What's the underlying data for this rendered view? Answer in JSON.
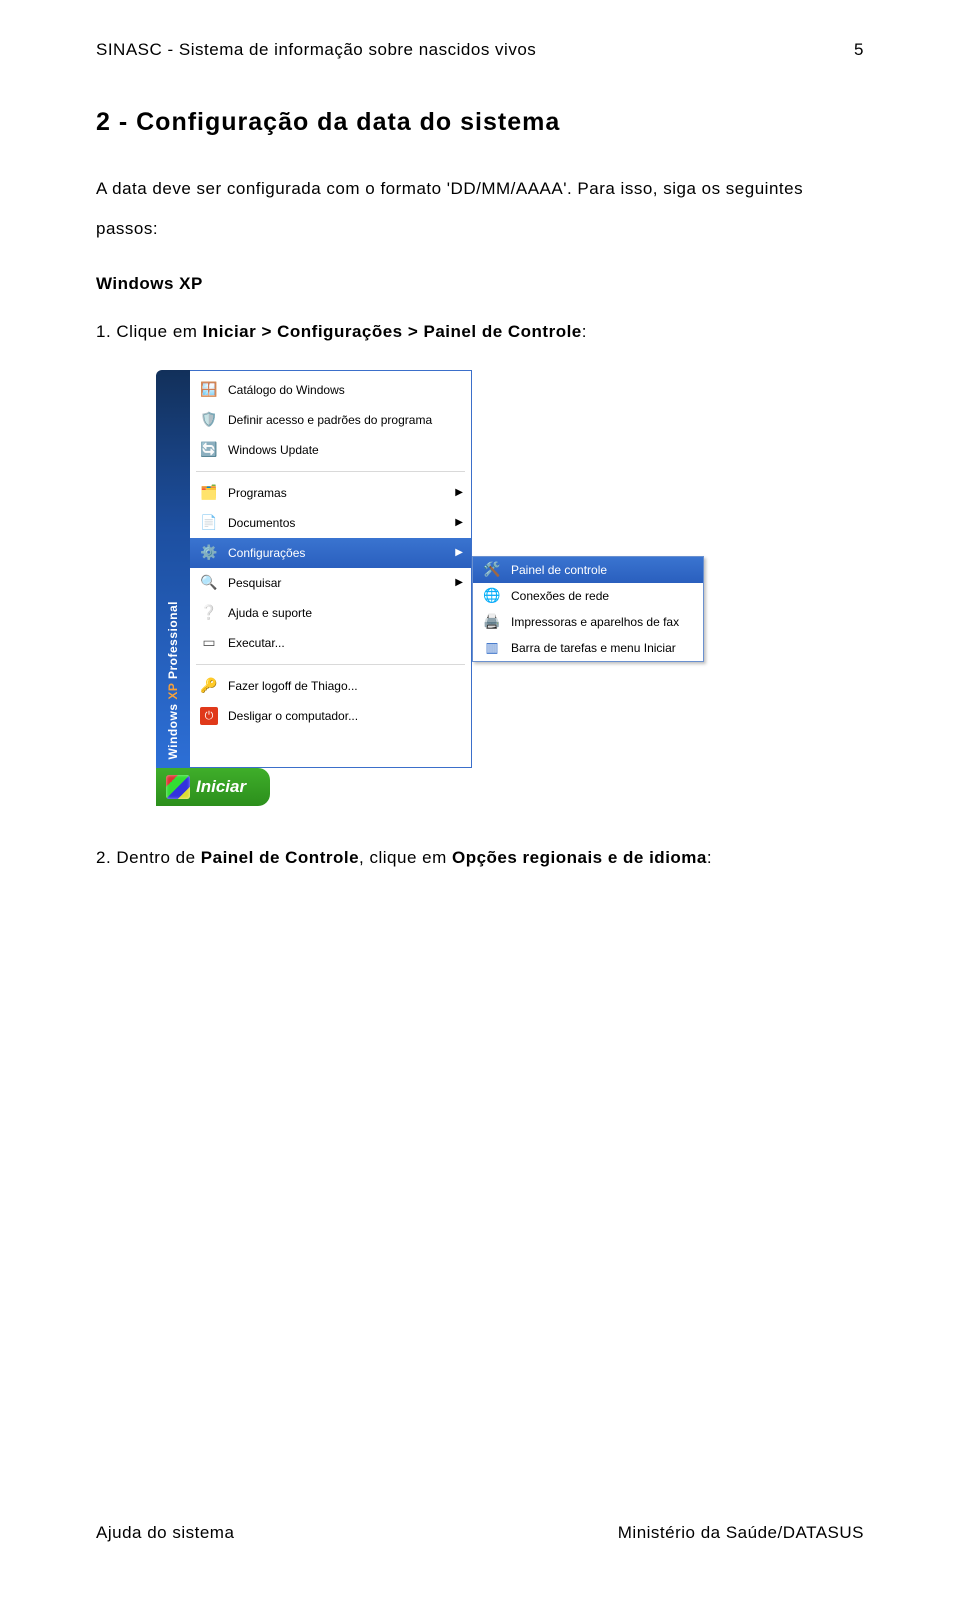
{
  "header": {
    "doc_title": "SINASC - Sistema de informação sobre nascidos vivos",
    "page_number": "5"
  },
  "section": {
    "title": "2 - Configuração da data do sistema",
    "intro_line1": "A data deve ser configurada com o formato 'DD/MM/AAAA'. Para isso, siga os seguintes",
    "intro_line2": "passos:",
    "subhead": "Windows XP",
    "step1_prefix": "1.  Clique em ",
    "step1_bold": "Iniciar > Configurações > Painel de Controle",
    "step1_suffix": ":",
    "step2_prefix": "2.  Dentro de ",
    "step2_bold1": "Painel de Controle",
    "step2_mid": ", clique em ",
    "step2_bold2": "Opções regionais e de idioma",
    "step2_suffix": ":"
  },
  "startmenu": {
    "sidebar_brand1": "Windows ",
    "sidebar_brand2": "XP ",
    "sidebar_brand3": "Professional",
    "items_top": [
      {
        "label": "Catálogo do Windows"
      },
      {
        "label": "Definir acesso e padrões do programa"
      },
      {
        "label": "Windows Update"
      }
    ],
    "items_mid": [
      {
        "label": "Programas",
        "arrow": true
      },
      {
        "label": "Documentos",
        "arrow": true
      },
      {
        "label": "Configurações",
        "arrow": true,
        "highlight": true
      },
      {
        "label": "Pesquisar",
        "arrow": true
      },
      {
        "label": "Ajuda e suporte"
      },
      {
        "label": "Executar..."
      }
    ],
    "items_bottom": [
      {
        "label": "Fazer logoff de Thiago..."
      },
      {
        "label": "Desligar o computador..."
      }
    ],
    "submenu": [
      {
        "label": "Painel de controle",
        "highlight": true
      },
      {
        "label": "Conexões de rede"
      },
      {
        "label": "Impressoras e aparelhos de fax"
      },
      {
        "label": "Barra de tarefas e menu Iniciar"
      }
    ],
    "start_label": "Iniciar"
  },
  "footer": {
    "left": "Ajuda do sistema",
    "right": "Ministério da Saúde/DATASUS"
  }
}
